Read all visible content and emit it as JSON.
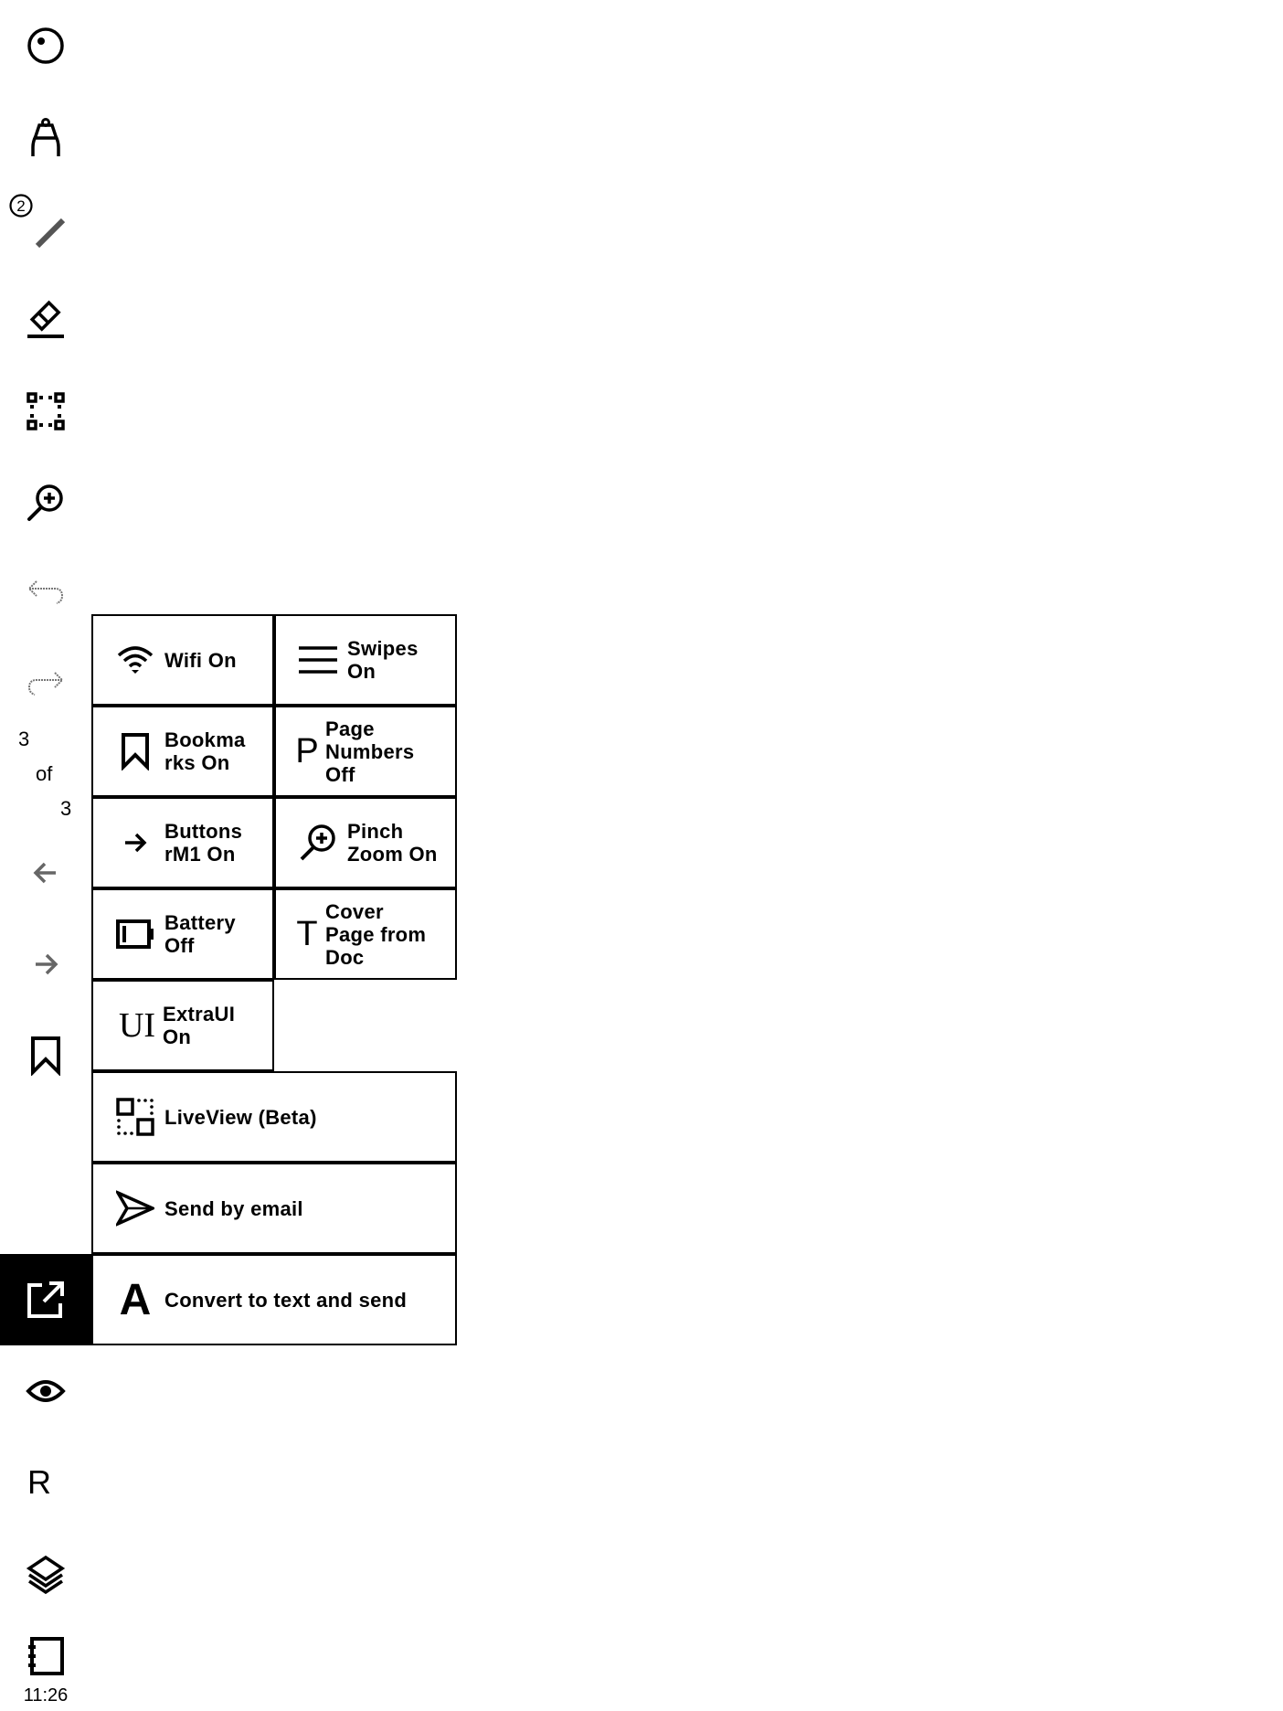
{
  "toolbar": {
    "items": [
      {
        "name": "menu-toggle",
        "icon": "circle-dot-icon"
      },
      {
        "name": "writing-tool",
        "icon": "pen-nib-icon"
      },
      {
        "name": "pen-tool",
        "icon": "pencil-stroke-icon",
        "badge": "2"
      },
      {
        "name": "eraser-tool",
        "icon": "eraser-icon"
      },
      {
        "name": "selection-tool",
        "icon": "selection-icon"
      },
      {
        "name": "zoom-tool",
        "icon": "zoom-in-icon"
      },
      {
        "name": "undo",
        "icon": "undo-icon"
      },
      {
        "name": "redo",
        "icon": "redo-icon"
      },
      {
        "name": "previous-page",
        "icon": "arrow-left-icon"
      },
      {
        "name": "next-page",
        "icon": "arrow-right-icon"
      },
      {
        "name": "bookmark",
        "icon": "bookmark-icon"
      },
      {
        "name": "share",
        "icon": "share-export-icon",
        "active": true
      },
      {
        "name": "view",
        "icon": "eye-icon"
      },
      {
        "name": "reader",
        "icon": "letter-r-icon",
        "text": "R"
      },
      {
        "name": "layers",
        "icon": "layers-icon"
      },
      {
        "name": "notebook",
        "icon": "notebook-icon"
      }
    ],
    "page_indicator": {
      "current": "3",
      "of": "of",
      "total": "3"
    },
    "clock": "11:26"
  },
  "panel": {
    "grid": [
      {
        "icon": "wifi-icon",
        "label": "Wifi On"
      },
      {
        "icon": "menu-lines-icon",
        "label": "Swipes On"
      },
      {
        "icon": "bookmark-icon",
        "label": "Bookmarks On"
      },
      {
        "icon": "letter-p-icon",
        "icon_text": "P",
        "label": "Page Numbers Off"
      },
      {
        "icon": "arrow-right-icon",
        "label": "Buttons rM1 On"
      },
      {
        "icon": "zoom-in-icon",
        "label": "Pinch Zoom On"
      },
      {
        "icon": "battery-icon",
        "label": "Battery Off"
      },
      {
        "icon": "letter-t-icon",
        "icon_text": "T",
        "label": "Cover Page from Doc"
      },
      {
        "icon": "ui-text-icon",
        "icon_text": "UI",
        "label": "ExtraUI On"
      }
    ],
    "actions": [
      {
        "icon": "liveview-icon",
        "label": "LiveView (Beta)"
      },
      {
        "icon": "send-icon",
        "label": "Send by email"
      },
      {
        "icon": "letter-a-icon",
        "icon_text": "A",
        "label": "Convert to text and send"
      }
    ]
  }
}
